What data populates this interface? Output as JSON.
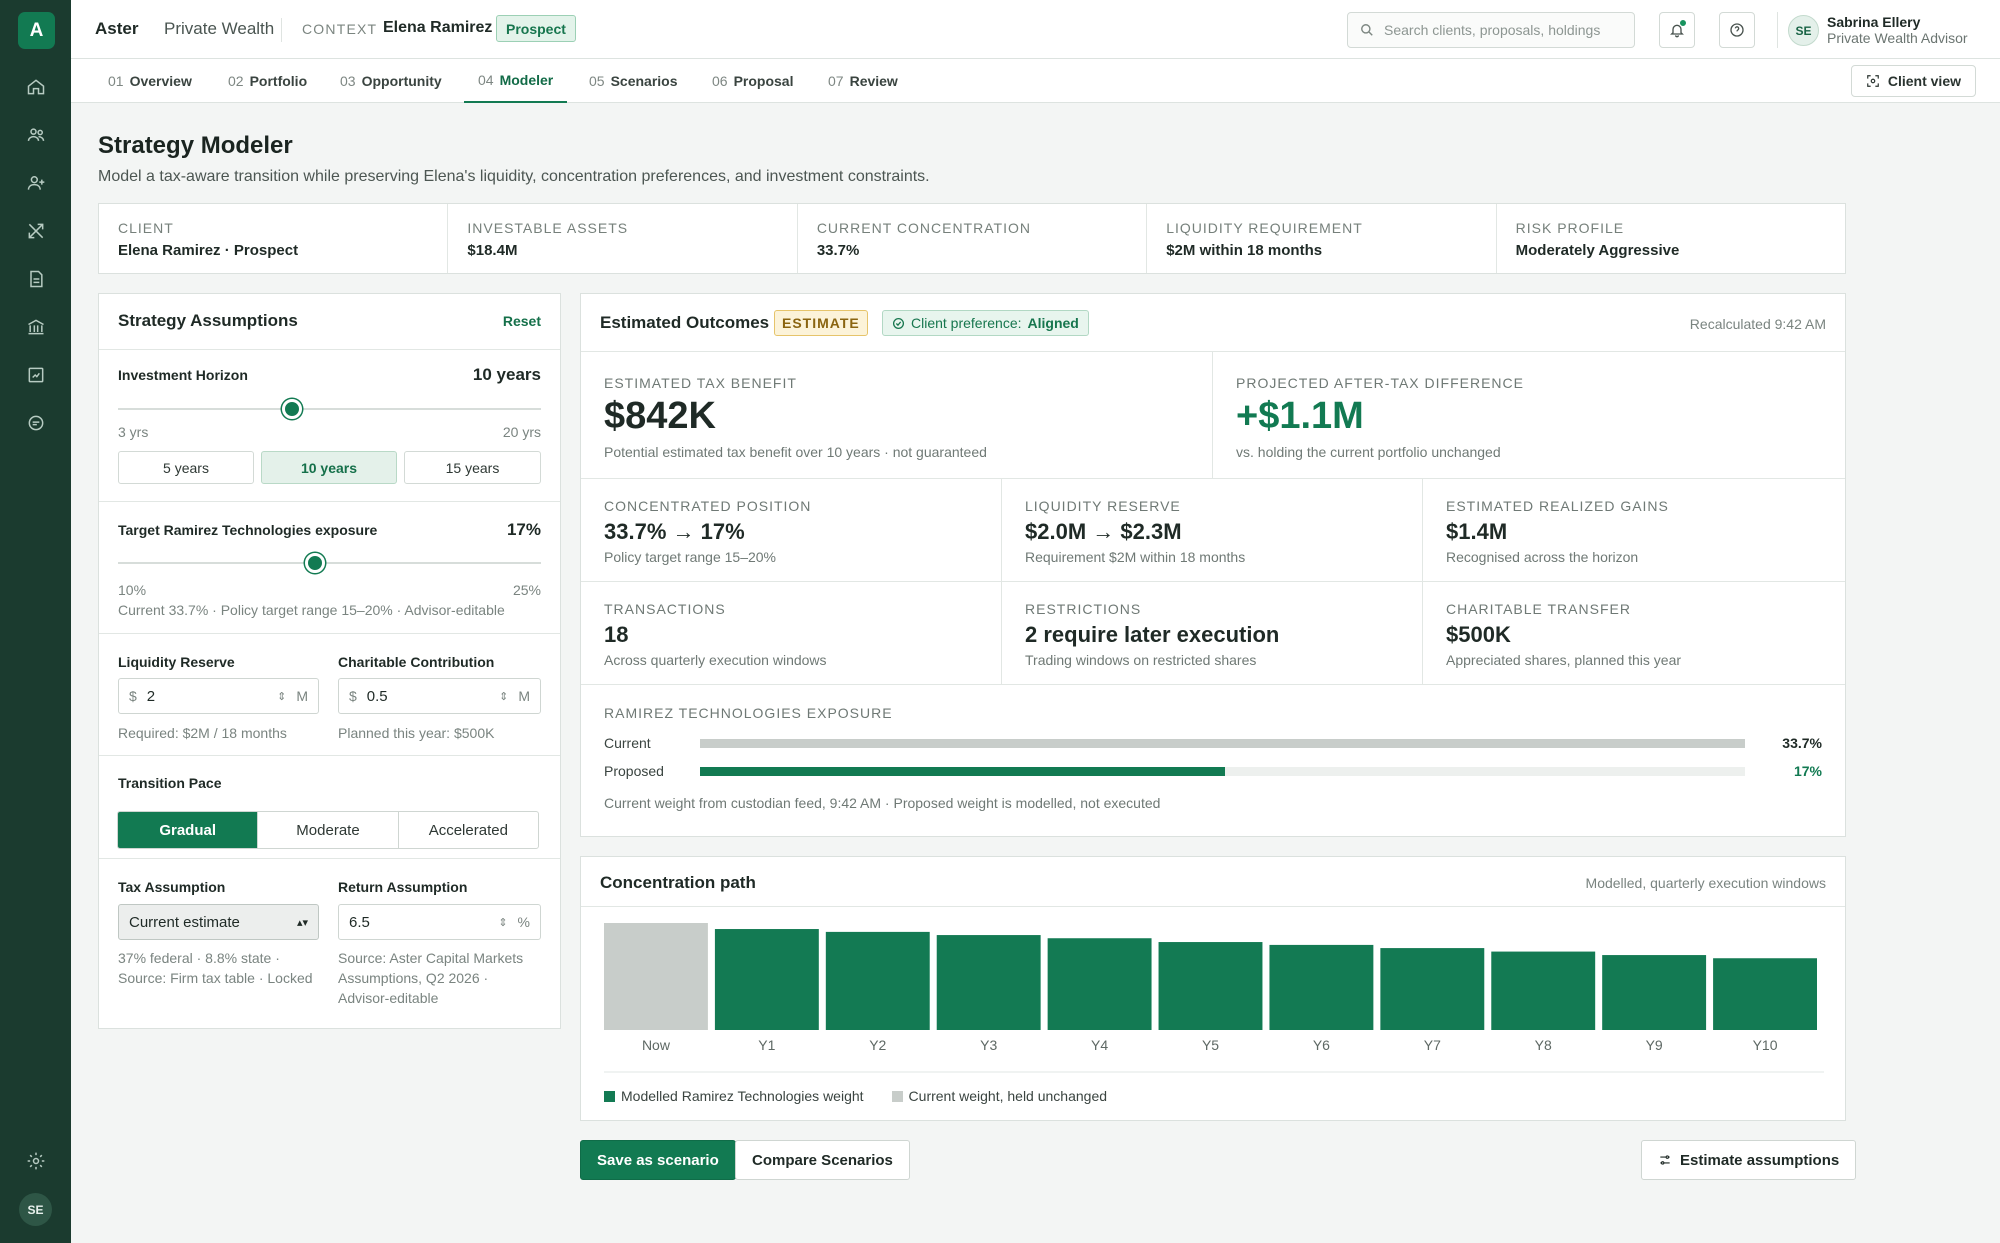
{
  "app": {
    "brand": "Aster",
    "brand_sub": "Private Wealth",
    "logo_letter": "A",
    "rail_avatar": "SE"
  },
  "header": {
    "context_label": "CONTEXT",
    "context_name": "Elena Ramirez",
    "context_badge": "Prospect",
    "search_placeholder": "Search clients, proposals, holdings",
    "user_initials": "SE",
    "user_name": "Sabrina Ellery",
    "user_role": "Private Wealth Advisor"
  },
  "tabs": [
    {
      "num": "01",
      "label": "Overview"
    },
    {
      "num": "02",
      "label": "Portfolio"
    },
    {
      "num": "03",
      "label": "Opportunity"
    },
    {
      "num": "04",
      "label": "Modeler"
    },
    {
      "num": "05",
      "label": "Scenarios"
    },
    {
      "num": "06",
      "label": "Proposal"
    },
    {
      "num": "07",
      "label": "Review"
    }
  ],
  "active_tab": "Modeler",
  "client_view_label": "Client view",
  "page": {
    "title": "Strategy Modeler",
    "subtitle": "Model a tax-aware transition while preserving Elena's liquidity, concentration preferences, and investment constraints."
  },
  "summary": [
    {
      "label": "CLIENT",
      "value": "Elena Ramirez · Prospect"
    },
    {
      "label": "INVESTABLE ASSETS",
      "value": "$18.4M"
    },
    {
      "label": "CURRENT CONCENTRATION",
      "value": "33.7%"
    },
    {
      "label": "LIQUIDITY REQUIREMENT",
      "value": "$2M within 18 months"
    },
    {
      "label": "RISK PROFILE",
      "value": "Moderately Aggressive"
    }
  ],
  "assumptions": {
    "title": "Strategy Assumptions",
    "reset": "Reset",
    "horizon": {
      "label": "Investment Horizon",
      "value": "10 years",
      "min_label": "3 yrs",
      "max_label": "20 yrs",
      "min": 3,
      "max": 20,
      "current": 10,
      "presets": [
        "5 years",
        "10 years",
        "15 years"
      ],
      "selected_preset": "10 years"
    },
    "exposure": {
      "label": "Target Ramirez Technologies exposure",
      "value": "17%",
      "min_label": "10%",
      "max_label": "25%",
      "min": 10,
      "max": 25,
      "current": 17,
      "note": "Current 33.7% · Policy target range 15–20% · Advisor-editable"
    },
    "liquidity": {
      "label": "Liquidity Reserve",
      "prefix": "$",
      "value": "2",
      "unit": "M",
      "note": "Required: $2M / 18 months"
    },
    "charitable": {
      "label": "Charitable Contribution",
      "prefix": "$",
      "value": "0.5",
      "unit": "M",
      "note": "Planned this year: $500K"
    },
    "pace": {
      "label": "Transition Pace",
      "options": [
        "Gradual",
        "Moderate",
        "Accelerated"
      ],
      "selected": "Gradual"
    },
    "tax": {
      "label": "Tax Assumption",
      "value": "Current estimate",
      "note1": "37% federal · 8.8% state ·",
      "note2": "Source: Firm tax table · Locked"
    },
    "return": {
      "label": "Return Assumption",
      "value": "6.5",
      "unit": "%",
      "note1": "Source: Aster Capital Markets",
      "note2": "Assumptions, Q2 2026 ·",
      "note3": "Advisor-editable"
    }
  },
  "outcomes": {
    "title": "Estimated Outcomes",
    "estimate_badge": "ESTIMATE",
    "pref_label": "Client preference:",
    "pref_value": "Aligned",
    "recalc": "Recalculated 9:42 AM",
    "tax_benefit": {
      "label": "ESTIMATED TAX BENEFIT",
      "value": "$842K",
      "sub": "Potential estimated tax benefit over 10 years · not guaranteed"
    },
    "after_tax": {
      "label": "PROJECTED AFTER-TAX DIFFERENCE",
      "value": "+$1.1M",
      "sub": "vs. holding the current portfolio unchanged"
    },
    "kpis": [
      {
        "label": "CONCENTRATED POSITION",
        "value": "33.7% → 17%",
        "sub": "Policy target range 15–20%"
      },
      {
        "label": "LIQUIDITY RESERVE",
        "value": "$2.0M → $2.3M",
        "sub": "Requirement $2M within 18 months"
      },
      {
        "label": "ESTIMATED REALIZED GAINS",
        "value": "$1.4M",
        "sub": "Recognised across the horizon"
      },
      {
        "label": "TRANSACTIONS",
        "value": "18",
        "sub": "Across quarterly execution windows"
      },
      {
        "label": "RESTRICTIONS",
        "value": "2 require later execution",
        "sub": "Trading windows on restricted shares"
      },
      {
        "label": "CHARITABLE TRANSFER",
        "value": "$500K",
        "sub": "Appreciated shares, planned this year"
      }
    ],
    "exposure": {
      "label": "RAMIREZ TECHNOLOGIES EXPOSURE",
      "current_label": "Current",
      "current_value": "33.7%",
      "current_pct": 33.7,
      "proposed_label": "Proposed",
      "proposed_value": "17%",
      "proposed_pct": 17,
      "note": "Current weight from custodian feed, 9:42 AM · Proposed weight is modelled, not executed"
    }
  },
  "path": {
    "title": "Concentration path",
    "subtitle": "Modelled, quarterly execution windows",
    "legend_modelled": "Modelled Ramirez Technologies weight",
    "legend_current": "Current weight, held unchanged"
  },
  "chart_data": {
    "type": "bar",
    "categories": [
      "Now",
      "Y1",
      "Y2",
      "Y3",
      "Y4",
      "Y5",
      "Y6",
      "Y7",
      "Y8",
      "Y9",
      "Y10"
    ],
    "values": [
      33.7,
      31.8,
      30.9,
      29.9,
      28.9,
      27.7,
      26.8,
      25.8,
      24.7,
      23.6,
      22.6
    ],
    "series": [
      {
        "name": "Modelled Ramirez Technologies weight",
        "color": "#137a53"
      },
      {
        "name": "Current weight, held unchanged",
        "color": "#c8cdca"
      }
    ],
    "ylim": [
      0,
      33.7
    ]
  },
  "actions": {
    "save": "Save as scenario",
    "compare": "Compare Scenarios",
    "estimate": "Estimate assumptions"
  },
  "colors": {
    "accent": "#127a52",
    "rail": "#1b3b2f",
    "estimate": "#fcf3d9"
  }
}
